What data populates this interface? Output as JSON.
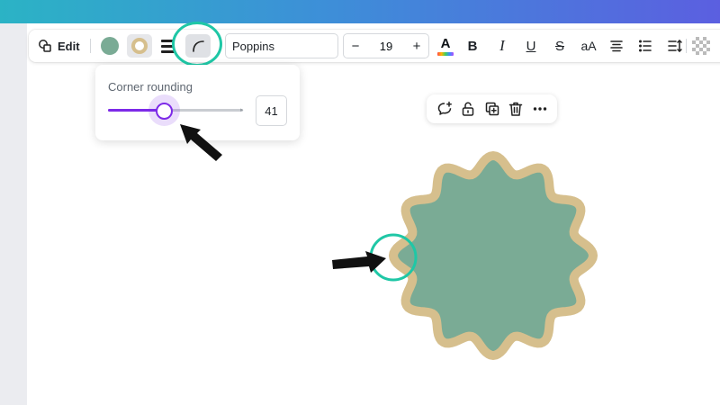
{
  "colors": {
    "shape_fill": "#7aab95",
    "shape_border": "#d6bf8d",
    "highlight_ring": "#1fc7a6",
    "slider_accent": "#7d2ae8",
    "top_bar_start": "#2bb3c5",
    "top_bar_end": "#5b5fe0"
  },
  "toolbar": {
    "edit_label": "Edit",
    "font_name": "Poppins",
    "font_size": "19",
    "decrease_label": "−",
    "increase_label": "+",
    "text_color_glyph": "A",
    "bold_glyph": "B",
    "italic_glyph": "I",
    "underline_glyph": "U",
    "strike_glyph": "S",
    "case_glyph": "aA",
    "icons": [
      "edit-shape-icon",
      "color-swatch",
      "border-color-icon",
      "border-style-icon",
      "corner-rounding-icon",
      "text-color-icon",
      "align-center-icon",
      "bullet-list-icon",
      "line-spacing-icon",
      "transparency-icon"
    ]
  },
  "corner_rounding": {
    "title": "Corner rounding",
    "value": "41",
    "slider_fraction": 0.41
  },
  "shape_actions": [
    "comment-add-icon",
    "unlock-icon",
    "duplicate-icon",
    "trash-icon",
    "more-icon"
  ]
}
